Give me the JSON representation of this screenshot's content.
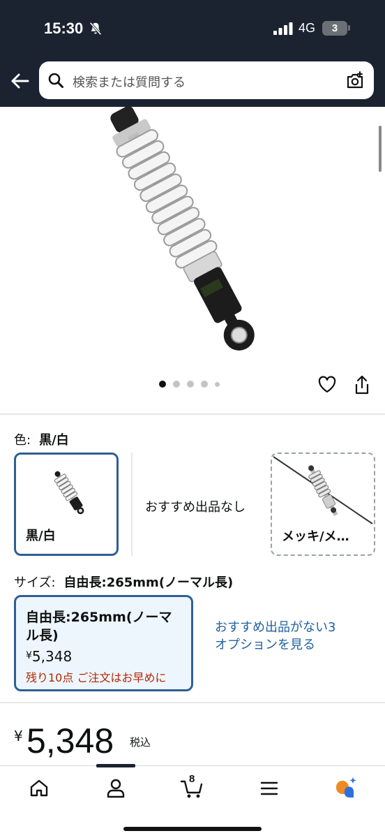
{
  "status_bar": {
    "time": "15:30",
    "network": "4G",
    "battery": "3",
    "icons": [
      "bell-slash-icon",
      "signal-icon",
      "battery-icon"
    ]
  },
  "header": {
    "search_placeholder": "検索または質問する",
    "icons": [
      "back-arrow-icon",
      "search-icon",
      "camera-search-icon"
    ]
  },
  "gallery": {
    "image_count": 5,
    "active_index": 0,
    "icons": [
      "heart-icon",
      "share-icon"
    ]
  },
  "color": {
    "label": "色:",
    "selected": "黒/白",
    "options": [
      {
        "name": "黒/白",
        "selected": true
      },
      {
        "name": "おすすめ出品なし",
        "selected": false
      },
      {
        "name": "メッキ/メ…",
        "selected": false
      }
    ]
  },
  "size": {
    "label": "サイズ:",
    "selected": "自由長:265mm(ノーマル長)",
    "option": {
      "name": "自由長:265mm(ノーマル長)",
      "price_symbol": "¥",
      "price": "5,348",
      "stock": "残り10点 ご注文はお早めに"
    },
    "more_link": "おすすめ出品がない3オプションを見る"
  },
  "price": {
    "currency": "¥",
    "amount": "5,348",
    "tax_note": "税込"
  },
  "bottom_nav": {
    "items": [
      "home-icon",
      "account-icon",
      "cart-icon",
      "menu-icon",
      "rufus-icon"
    ],
    "cart_count": "8",
    "active_index": 1
  },
  "colors": {
    "header_bg": "#1b2331",
    "selected_border": "#2f5f96",
    "link": "#2162a1",
    "stock_red": "#b12704",
    "selected_fill": "#eef6fd"
  }
}
